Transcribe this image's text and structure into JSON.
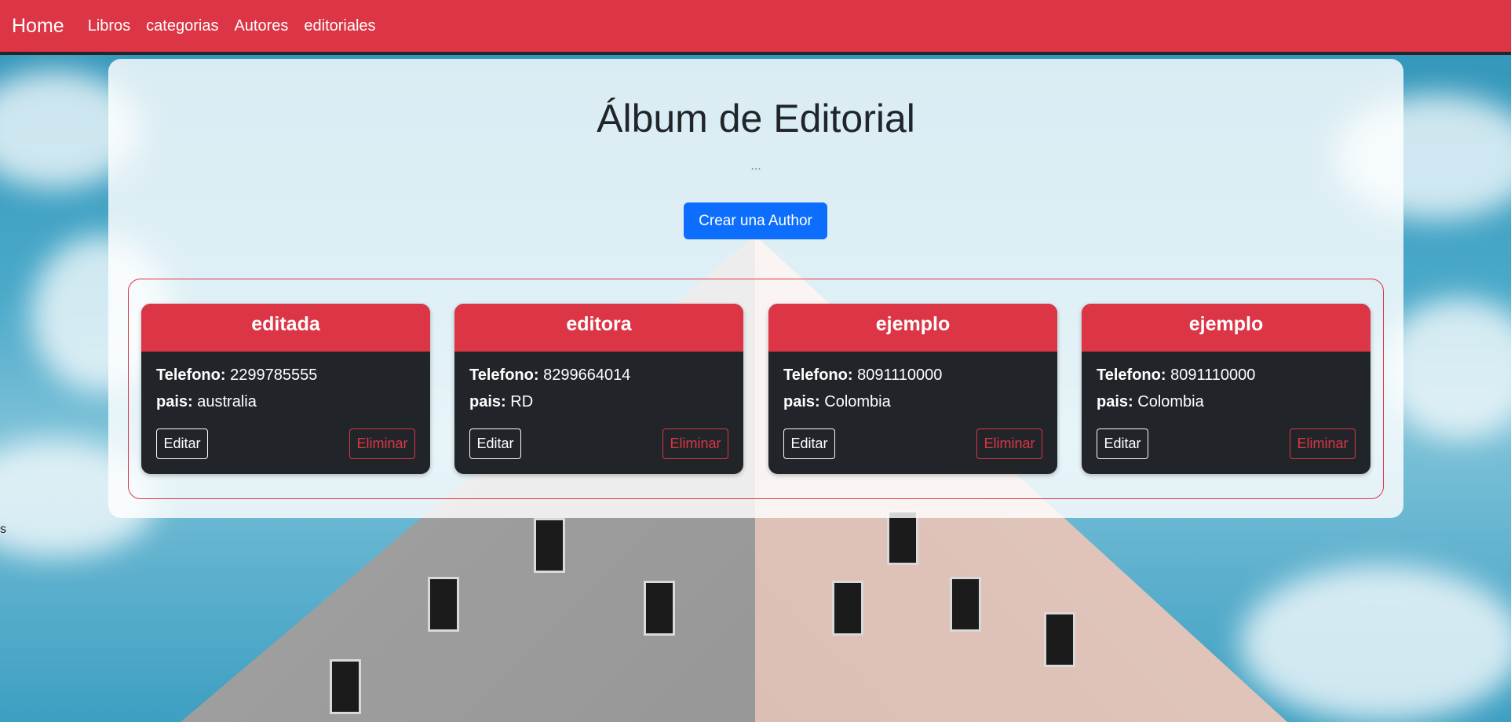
{
  "navbar": {
    "brand": "Home",
    "links": [
      "Libros",
      "categorias",
      "Autores",
      "editoriales"
    ]
  },
  "side_text": "s",
  "header": {
    "title": "Álbum de Editorial",
    "subtitle": "...",
    "create_button": "Crear una Author"
  },
  "labels": {
    "telefono": "Telefono:",
    "pais": "pais:",
    "edit": "Editar",
    "delete": "Eliminar"
  },
  "cards": [
    {
      "name": "editada",
      "telefono": "2299785555",
      "pais": "australia"
    },
    {
      "name": "editora",
      "telefono": "8299664014",
      "pais": "RD"
    },
    {
      "name": "ejemplo",
      "telefono": "8091110000",
      "pais": "Colombia"
    },
    {
      "name": "ejemplo",
      "telefono": "8091110000",
      "pais": "Colombia"
    }
  ],
  "colors": {
    "navbar": "#dc3545",
    "primary": "#0d6efd",
    "card_body": "#212529"
  }
}
